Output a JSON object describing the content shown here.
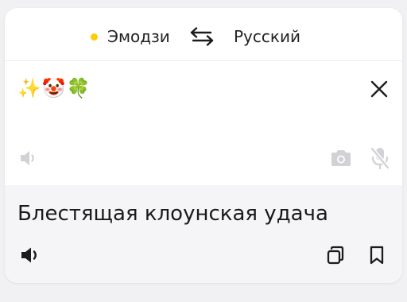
{
  "languages": {
    "source": "Эмодзи",
    "target": "Русский",
    "source_dot_color": "#ffcc00"
  },
  "input": {
    "text": "✨🤡🍀"
  },
  "output": {
    "text": "Блестящая клоунская удача"
  },
  "icons": {
    "swap": "swap-arrows-icon",
    "clear": "close-icon",
    "source_speaker": "speaker-icon",
    "camera": "camera-icon",
    "mic": "microphone-off-icon",
    "output_speaker": "speaker-icon",
    "copy": "copy-icon",
    "bookmark": "bookmark-icon"
  },
  "colors": {
    "background": "#f1f1f3",
    "card": "#ffffff",
    "output_bg": "#f5f5f7",
    "disabled_icon": "#c7c7cc",
    "active_icon": "#1c1c1e"
  }
}
